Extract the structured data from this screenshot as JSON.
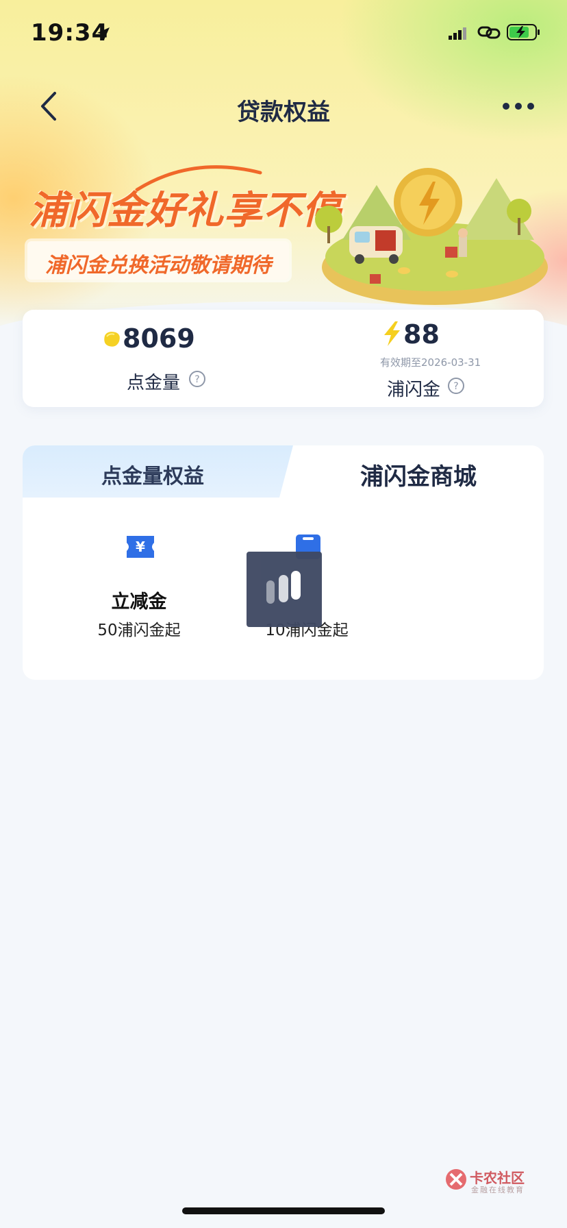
{
  "status_bar": {
    "time": "19:34"
  },
  "nav": {
    "title": "贷款权益"
  },
  "banner": {
    "title": "浦闪金好礼享不停",
    "subtitle": "浦闪金兑换活动敬请期待"
  },
  "points": {
    "dianjin_value": "8069",
    "dianjin_label": "点金量",
    "pushanjin_value": "88",
    "pushanjin_expiry": "有效期至2026-03-31",
    "pushanjin_label": "浦闪金"
  },
  "tabs": [
    {
      "label": "点金量权益",
      "active": false
    },
    {
      "label": "浦闪金商城",
      "active": true
    }
  ],
  "items": [
    {
      "name": "立减金",
      "desc": "50浦闪金起",
      "icon": "voucher-icon"
    },
    {
      "name": "",
      "desc": "10浦闪金起",
      "icon": "card-icon"
    }
  ],
  "watermark": {
    "title": "卡农社区",
    "subtitle": "金融在线教育"
  },
  "colors": {
    "accent": "#f0682a",
    "primary_text": "#1f2a44",
    "icon_blue": "#2f6fe6"
  }
}
